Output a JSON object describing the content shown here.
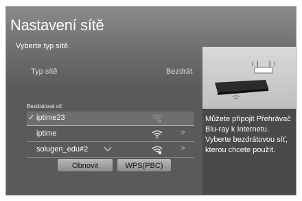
{
  "title": "Nastavení sítě",
  "subtitle": "Vyberte typ sítě.",
  "network_type": {
    "label": "Typ sítě",
    "value": "Bezdrát."
  },
  "list": {
    "label": "Bezdrátová síť",
    "items": [
      {
        "name": "iptime23",
        "selected": true,
        "check": "✓",
        "chevron": ""
      },
      {
        "name": "iptime",
        "selected": false,
        "check": "",
        "chevron": ">"
      },
      {
        "name": "solugen_edu#2",
        "selected": false,
        "check": "",
        "chevron": ">"
      }
    ]
  },
  "help_text": "Můžete připojit Přehrávač Blu-ray k Internetu. Vyberte bezdrátovou síť, kterou chcete použít.",
  "buttons": {
    "refresh": "Obnovit",
    "wps": "WPS(PBC)"
  },
  "icons": {
    "wifi": "wifi-signal-icon",
    "router": "router-icon",
    "player": "bluray-player-icon"
  }
}
